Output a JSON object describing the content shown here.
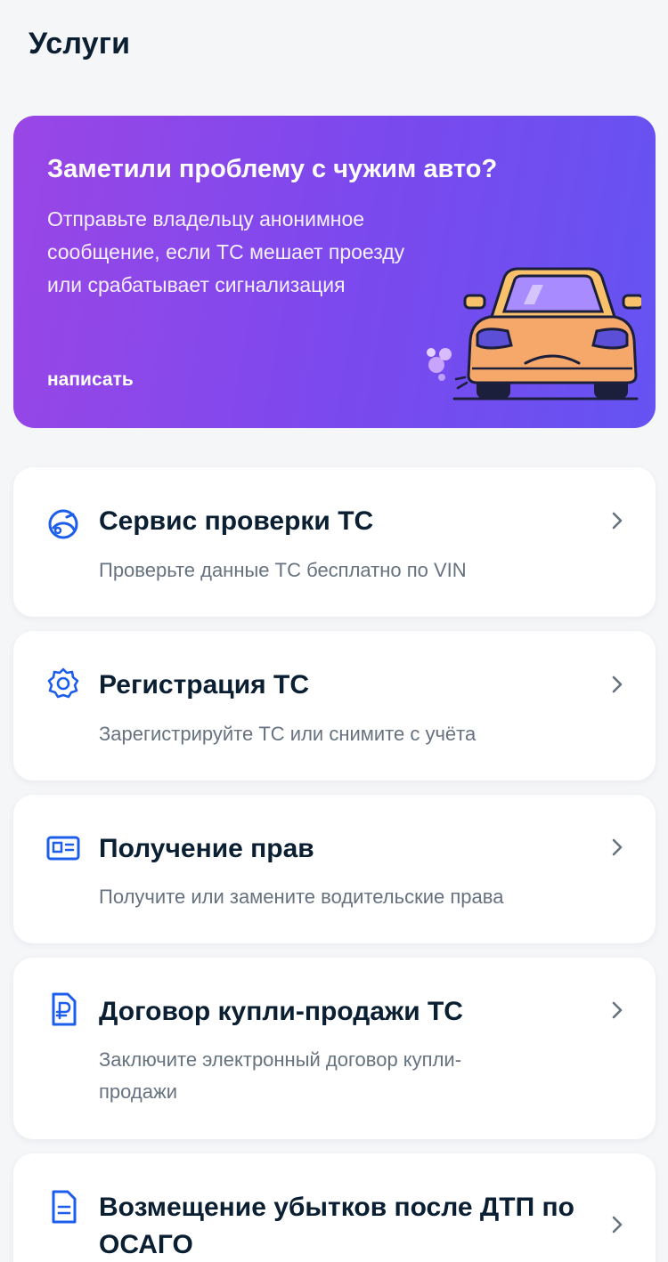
{
  "page": {
    "title": "Услуги"
  },
  "promo": {
    "title": "Заметили проблему с чужим авто?",
    "text": "Отправьте владельцу анонимное сообщение, если ТС мешает проезду или срабатывает сигнализация",
    "link": "написать",
    "gradient_start": "#9a46e6",
    "gradient_end": "#6553f2",
    "illustration": "angry-car-illustration"
  },
  "accent_color": "#1d5deb",
  "services": [
    {
      "title": "Сервис проверки ТС",
      "subtitle": "Проверьте данные ТС бесплатно по VIN",
      "icon": "car-search-icon"
    },
    {
      "title": "Регистрация ТС",
      "subtitle": "Зарегистрируйте ТС или снимите с учёта",
      "icon": "badge-icon"
    },
    {
      "title": "Получение прав",
      "subtitle": "Получите или замените водительские права",
      "icon": "id-card-icon"
    },
    {
      "title": "Договор купли-продажи ТС",
      "subtitle": "Заключите электронный договор купли-продажи",
      "icon": "ruble-document-icon"
    },
    {
      "title": "Возмещение убытков после ДТП по ОСАГО",
      "subtitle": "",
      "icon": "document-icon"
    }
  ]
}
